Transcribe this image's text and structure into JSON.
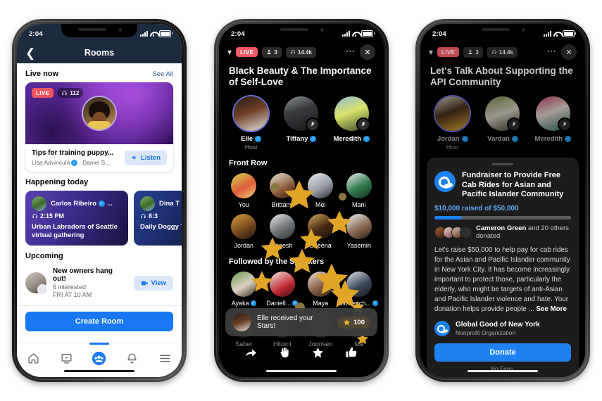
{
  "phone1": {
    "status": {
      "time": "2:04"
    },
    "nav": {
      "back_icon": "chevron-left-icon",
      "title": "Rooms"
    },
    "live_now": {
      "title": "Live now",
      "see_all": "See All"
    },
    "live_card": {
      "live_badge": "LIVE",
      "listener_count": "112",
      "headphone_icon": "headphones-icon",
      "title": "Tips for training puppy...",
      "subtitle_a": "Lisa Advincula",
      "subtitle_b": ", Daniel S...",
      "listen_label": "Listen",
      "speaker_icon": "speaker-icon"
    },
    "happening": {
      "title": "Happening today",
      "cards": [
        {
          "name": "Carlos Ribeiro",
          "name_suffix": "...",
          "time": "2:15 PM",
          "desc": "Urban Labradors of Seattle virtual gathering"
        },
        {
          "name": "Dina T",
          "time": "8:3",
          "desc": "Daily Doggy T"
        }
      ]
    },
    "upcoming": {
      "title": "Upcoming",
      "event": {
        "name": "New owners hang out!",
        "interested": "6 interested",
        "when": "FRI AT 10 AM",
        "view_label": "View",
        "video_icon": "video-camera-icon"
      }
    },
    "create_room_label": "Create Room",
    "tabs": [
      {
        "name": "home-icon",
        "active": false
      },
      {
        "name": "watch-icon",
        "active": false
      },
      {
        "name": "groups-icon",
        "active": true
      },
      {
        "name": "notifications-bell-icon",
        "active": false
      },
      {
        "name": "menu-hamburger-icon",
        "active": false
      }
    ]
  },
  "phone2": {
    "status": {
      "time": "2:04"
    },
    "roombar": {
      "chevron_icon": "chevron-down-icon",
      "live_badge": "LIVE",
      "people_count": "3",
      "people_icon": "person-icon",
      "listener_count": "14.4k",
      "headphone_icon": "headphones-icon",
      "more_icon": "ellipsis-icon",
      "close_icon": "close-x-icon"
    },
    "title": "Black Beauty & The Importance of Self-Love",
    "speakers": [
      {
        "name": "Elle",
        "role": "Host",
        "verified": true,
        "muted": false
      },
      {
        "name": "Tiffany",
        "role": "",
        "verified": true,
        "muted": true
      },
      {
        "name": "Meredith",
        "role": "",
        "verified": true,
        "muted": true
      }
    ],
    "front_row_title": "Front Row",
    "front_row": [
      [
        "You",
        "Brittany",
        "Mei",
        "Mani"
      ],
      [
        "Jordan",
        "Yogesh",
        "Sheena",
        "Yasemin"
      ]
    ],
    "followed_title": "Followed by the Speakers",
    "followed": [
      [
        {
          "n": "Ayaka",
          "v": true
        },
        {
          "n": "Daniell...",
          "v": true
        },
        {
          "n": "Maya",
          "v": false
        },
        {
          "n": "Wolfesch...",
          "v": true
        }
      ],
      [
        {
          "n": "Saber",
          "v": false
        },
        {
          "n": "Hitomi",
          "v": false
        },
        {
          "n": "Joonseo",
          "v": false
        },
        {
          "n": "Ma",
          "v": false
        }
      ]
    ],
    "toast": {
      "message": "Elle received your Stars!",
      "count": "100",
      "star_icon": "star-icon",
      "avatar": "elle-avatar"
    },
    "actions": [
      {
        "name": "share-arrow-icon"
      },
      {
        "name": "raise-hand-icon"
      },
      {
        "name": "send-star-icon"
      },
      {
        "name": "thumbs-up-icon"
      }
    ]
  },
  "phone3": {
    "status": {
      "time": "2:04"
    },
    "roombar": {
      "chevron_icon": "chevron-down-icon",
      "live_badge": "LIVE",
      "people_count": "3",
      "people_icon": "person-icon",
      "listener_count": "14.4k",
      "headphone_icon": "headphones-icon",
      "more_icon": "ellipsis-icon",
      "close_icon": "close-x-icon"
    },
    "title": "Let's Talk About Supporting the API Community",
    "speakers": [
      {
        "name": "Jordan",
        "role": "Host",
        "verified": true,
        "muted": false
      },
      {
        "name": "Vardan",
        "role": "",
        "verified": true,
        "muted": true
      },
      {
        "name": "Meredith",
        "role": "",
        "verified": true,
        "muted": true
      }
    ],
    "fundraiser": {
      "logo_icon": "charity-globe-icon",
      "title": "Fundraiser to Provide Free Cab Rides for Asian and Pacific Islander Community",
      "raised_text": "$10,000 raised of $50,000",
      "progress_percent": 20,
      "donors_bold": "Cameron Green",
      "donors_rest": " and 20 others donated",
      "body": "Let's raise $50,000 to help pay for cab rides for the Asian and Pacific Islander community in New York City. It has become increasingly important to protect those, particularly the elderly, who might be targets of anti-Asian and Pacific Islander violence and hate. Your donation helps provide people ... ",
      "see_more": "See More",
      "org_name": "Global Good of New York",
      "org_type": "Nonprofit Organization",
      "donate_label": "Donate",
      "no_fees": "No Fees."
    }
  },
  "colors": {
    "facebook_blue": "#1877f2",
    "live_red": "#ef5a63",
    "nav_navy": "#1d2b41",
    "star_gold": "#e0a526",
    "page_bg": "#ffffff"
  }
}
